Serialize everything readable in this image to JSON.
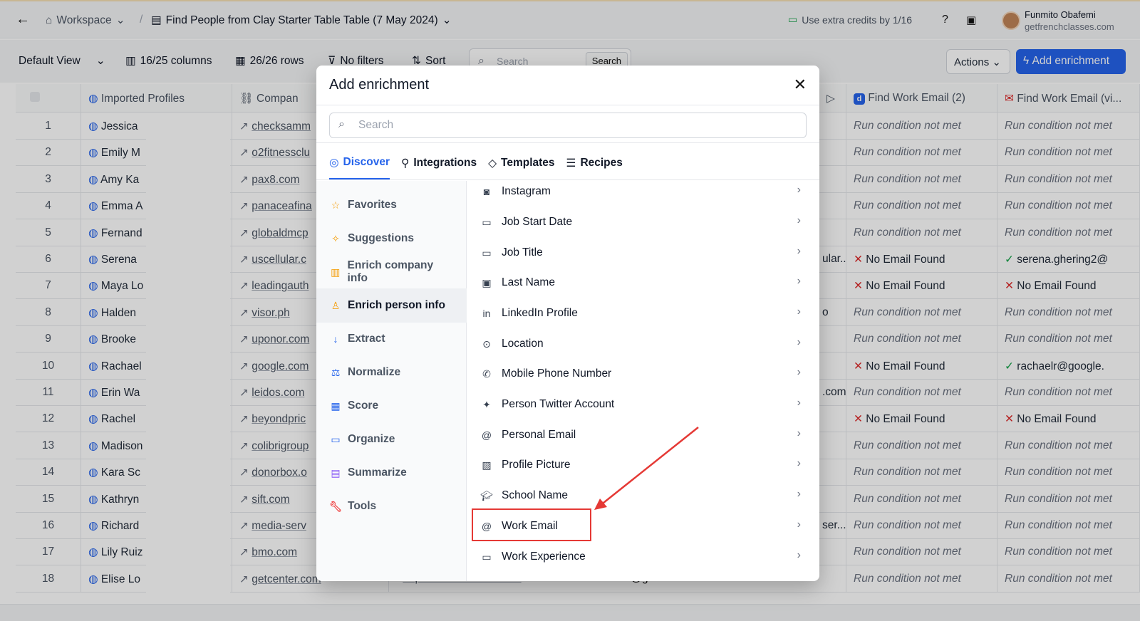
{
  "header": {
    "workspace": "Workspace",
    "separator": "/",
    "table_title": "Find People from Clay Starter Table Table (7 May 2024)",
    "credits_text": "Use extra credits by 1/16",
    "user_name": "Funmito Obafemi",
    "user_domain": "getfrenchclasses.com"
  },
  "toolbar": {
    "view": "Default View",
    "columns": "16/25 columns",
    "rows": "26/26 rows",
    "filters": "No filters",
    "sort": "Sort",
    "search_placeholder": "Search",
    "search_button": "Search",
    "actions": "Actions",
    "add_enrichment": "Add enrichment"
  },
  "grid": {
    "headers": {
      "imported": "Imported Profiles",
      "company": "Compan",
      "work_email_2": "Find Work Email (2)",
      "work_email_vi": "Find Work Email (vi..."
    },
    "rows": [
      {
        "n": "1",
        "name": "Jessica",
        "domain": "checksamm",
        "mid": "",
        "c1": "Run condition not met",
        "c2": "Run condition not met"
      },
      {
        "n": "2",
        "name": "Emily M",
        "domain": "o2fitnessclu",
        "mid": "",
        "c1": "Run condition not met",
        "c2": "Run condition not met"
      },
      {
        "n": "3",
        "name": "Amy Ka",
        "domain": "pax8.com",
        "mid": "",
        "c1": "Run condition not met",
        "c2": "Run condition not met"
      },
      {
        "n": "4",
        "name": "Emma A",
        "domain": "panaceafina",
        "mid": "",
        "c1": "Run condition not met",
        "c2": "Run condition not met"
      },
      {
        "n": "5",
        "name": "Fernand",
        "domain": "globaldmcp",
        "mid": "",
        "c1": "Run condition not met",
        "c2": "Run condition not met"
      },
      {
        "n": "6",
        "name": "Serena",
        "domain": "uscellular.c",
        "mid": "ular...",
        "c1": "✕ No Email Found",
        "c2": "✓ serena.ghering2@"
      },
      {
        "n": "7",
        "name": "Maya Lo",
        "domain": "leadingauth",
        "mid": "",
        "c1": "✕ No Email Found",
        "c2": "✕ No Email Found"
      },
      {
        "n": "8",
        "name": "Halden",
        "domain": "visor.ph",
        "mid": "o",
        "c1": "Run condition not met",
        "c2": "Run condition not met"
      },
      {
        "n": "9",
        "name": "Brooke",
        "domain": "uponor.com",
        "mid": "",
        "c1": "Run condition not met",
        "c2": "Run condition not met"
      },
      {
        "n": "10",
        "name": "Rachael",
        "domain": "google.com",
        "mid": "",
        "c1": "✕ No Email Found",
        "c2": "✓ rachaelr@google."
      },
      {
        "n": "11",
        "name": "Erin Wa",
        "domain": "leidos.com",
        "mid": ".com",
        "c1": "Run condition not met",
        "c2": "Run condition not met"
      },
      {
        "n": "12",
        "name": "Rachel",
        "domain": "beyondpric",
        "mid": "",
        "c1": "✕ No Email Found",
        "c2": "✕ No Email Found"
      },
      {
        "n": "13",
        "name": "Madison",
        "domain": "colibrigroup",
        "mid": "",
        "c1": "Run condition not met",
        "c2": "Run condition not met"
      },
      {
        "n": "14",
        "name": "Kara Sc",
        "domain": "donorbox.o",
        "mid": "",
        "c1": "Run condition not met",
        "c2": "Run condition not met"
      },
      {
        "n": "15",
        "name": "Kathryn",
        "domain": "sift.com",
        "mid": "",
        "c1": "Run condition not met",
        "c2": "Run condition not met"
      },
      {
        "n": "16",
        "name": "Richard",
        "domain": "media-serv",
        "mid": "ser...",
        "c1": "Run condition not met",
        "c2": "Run condition not met"
      },
      {
        "n": "17",
        "name": "Lily Ruiz",
        "domain": "bmo.com",
        "mid": "",
        "c1": "Run condition not met",
        "c2": "Run condition not met"
      },
      {
        "n": "18",
        "name": "Elise Lo",
        "domain": "getcenter.com",
        "mid": "",
        "c1": "Run condition not met",
        "c2": "Run condition not met"
      }
    ],
    "row18_extra": {
      "linkedin": "https://linkedin.com/in/...",
      "email": "elise.cardenas@ge...",
      "cond": "Run condition not met"
    }
  },
  "modal": {
    "title": "Add enrichment",
    "search_placeholder": "Search",
    "tabs": [
      "Discover",
      "Integrations",
      "Templates",
      "Recipes"
    ],
    "sidebar": [
      "Favorites",
      "Suggestions",
      "Enrich company info",
      "Enrich person info",
      "Extract",
      "Normalize",
      "Score",
      "Organize",
      "Summarize",
      "Tools"
    ],
    "items": [
      "Instagram",
      "Job Start Date",
      "Job Title",
      "Last Name",
      "LinkedIn Profile",
      "Location",
      "Mobile Phone Number",
      "Person Twitter Account",
      "Personal Email",
      "Profile Picture",
      "School Name",
      "Work Email",
      "Work Experience"
    ]
  },
  "colors": {
    "accent": "#2563eb",
    "highlight": "#e53935"
  }
}
